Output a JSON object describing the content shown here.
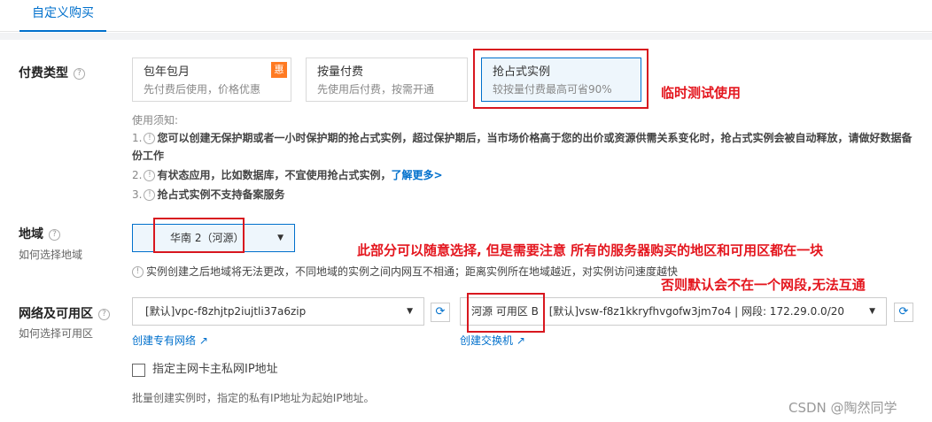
{
  "tab": {
    "label": "自定义购买"
  },
  "billing": {
    "label": "付费类型",
    "help": "?",
    "options": [
      {
        "title": "包年包月",
        "desc": "先付费后使用，价格优惠",
        "badge": "惠"
      },
      {
        "title": "按量付费",
        "desc": "先使用后付费，按需开通"
      },
      {
        "title": "抢占式实例",
        "desc": "较按量付费最高可省90%"
      }
    ],
    "annotation": "临时测试使用"
  },
  "notice": {
    "title": "使用须知:",
    "items": [
      {
        "num": "1.",
        "icon": "!",
        "text_a": "您可以创建无保护期或者一小时保护期的抢占式实例，超过保护期后，当市场价格高于您的出价或资源供需关系变化时，抢占式实例会被自动释放，请做好数据备",
        "text_b": "份工作"
      },
      {
        "num": "2.",
        "icon": "!",
        "text": "有状态应用，比如数据库，不宜使用抢占式实例，",
        "link": "了解更多>"
      },
      {
        "num": "3.",
        "icon": "!",
        "text": "抢占式实例不支持备案服务"
      }
    ]
  },
  "region": {
    "label": "地域",
    "help": "?",
    "sublabel": "如何选择地域",
    "value": "华南 2（河源）",
    "caret": "▼",
    "warning_icon": "!",
    "warning": "实例创建之后地域将无法更改，不同地域的实例之间内网互不相通；距离实例所在地域越近，对实例访问速度越快",
    "annotation1": "此部分可以随意选择, 但是需要注意 所有的服务器购买的地区和可用区都在一块",
    "annotation2": "否则默认会不在一个网段,无法互通"
  },
  "network": {
    "label": "网络及可用区",
    "help": "?",
    "sublabel": "如何选择可用区",
    "vpc_value": "[默认]vpc-f8zhjtp2iujtli37a6zip",
    "vpc_caret": "▼",
    "refresh_icon": "⟳",
    "create_vpc": "创建专有网络",
    "external_icon": "↗",
    "zone_label": "河源 可用区 B",
    "vsw_value": "[默认]vsw-f8z1kkryfhvgofw3jm7o4 | 网段: 172.29.0.0/20",
    "vsw_caret": "▼",
    "create_vsw": "创建交换机",
    "checkbox_label": "指定主网卡主私网IP地址",
    "hint": "批量创建实例时，指定的私有IP地址为起始IP地址。"
  },
  "watermark": "CSDN @陶然同学"
}
